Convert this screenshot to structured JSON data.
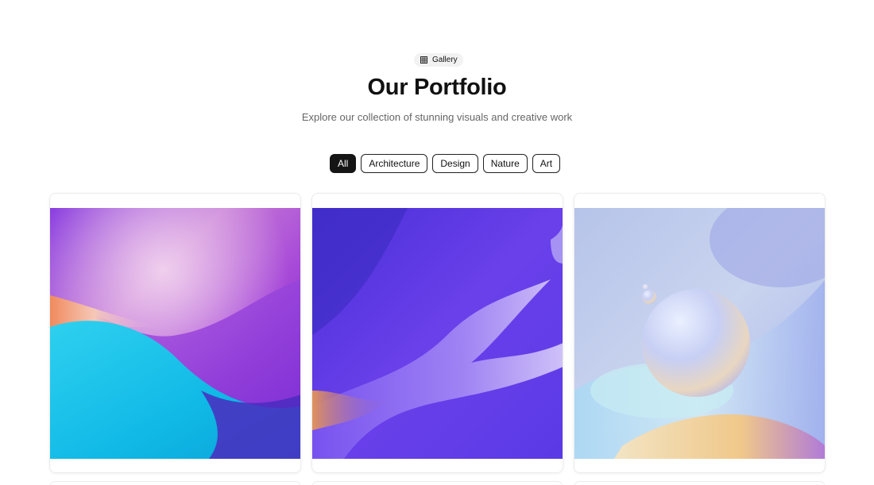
{
  "header": {
    "badge_label": "Gallery",
    "badge_icon": "grid-icon",
    "title": "Our Portfolio",
    "subtitle": "Explore our collection of stunning visuals and creative work"
  },
  "filters": [
    {
      "label": "All",
      "active": true
    },
    {
      "label": "Architecture",
      "active": false
    },
    {
      "label": "Design",
      "active": false
    },
    {
      "label": "Nature",
      "active": false
    },
    {
      "label": "Art",
      "active": false
    }
  ],
  "colors": {
    "active_filter_bg": "#151515",
    "border": "#222222",
    "subtitle": "#666666"
  }
}
